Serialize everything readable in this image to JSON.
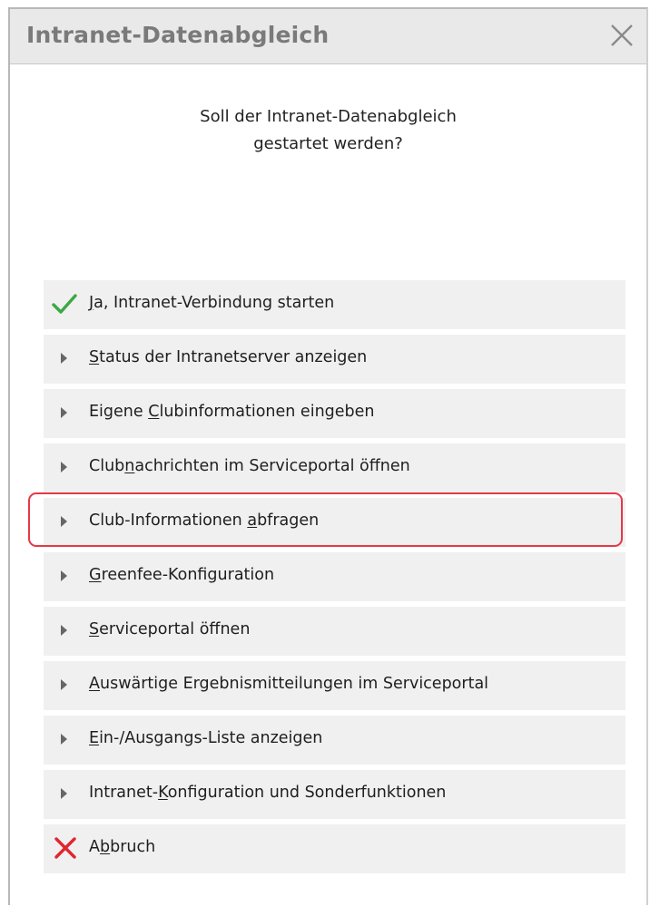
{
  "dialog": {
    "title": "Intranet-Datenabgleich",
    "close_icon": "close-icon"
  },
  "question": {
    "line1": "Soll der Intranet-Datenabgleich",
    "line2": "gestartet werden?"
  },
  "menu": {
    "items": [
      {
        "icon": "checkmark-icon",
        "pre": "",
        "key": "J",
        "post": "a, Intranet-Verbindung starten"
      },
      {
        "icon": "triangle-right-icon",
        "pre": "",
        "key": "S",
        "post": "tatus der Intranetserver anzeigen"
      },
      {
        "icon": "triangle-right-icon",
        "pre": "Eigene ",
        "key": "C",
        "post": "lubinformationen eingeben"
      },
      {
        "icon": "triangle-right-icon",
        "pre": "Club",
        "key": "n",
        "post": "achrichten im Serviceportal öffnen"
      },
      {
        "icon": "triangle-right-icon",
        "pre": "Club-Informationen ",
        "key": "a",
        "post": "bfragen"
      },
      {
        "icon": "triangle-right-icon",
        "pre": "",
        "key": "G",
        "post": "reenfee-Konfiguration"
      },
      {
        "icon": "triangle-right-icon",
        "pre": "",
        "key": "S",
        "post": "erviceportal öffnen"
      },
      {
        "icon": "triangle-right-icon",
        "pre": "",
        "key": "A",
        "post": "uswärtige Ergebnismitteilungen im Serviceportal"
      },
      {
        "icon": "triangle-right-icon",
        "pre": "",
        "key": "E",
        "post": "in-/Ausgangs-Liste anzeigen"
      },
      {
        "icon": "triangle-right-icon",
        "pre": "Intranet-",
        "key": "K",
        "post": "onfiguration und Sonderfunktionen"
      },
      {
        "icon": "cross-icon",
        "pre": "A",
        "key": "b",
        "post": "bruch"
      }
    ]
  },
  "colors": {
    "check": "#3aa843",
    "cross": "#e0262f",
    "highlight": "#e53945"
  }
}
